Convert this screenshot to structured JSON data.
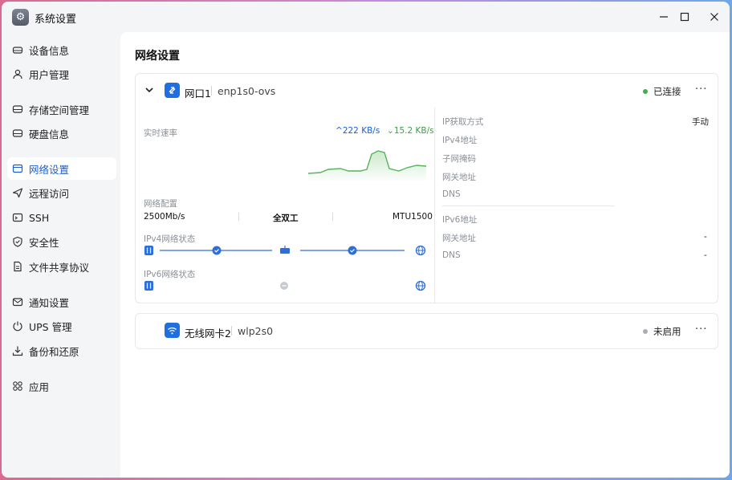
{
  "window": {
    "title": "系统设置"
  },
  "sidebar": {
    "items": [
      {
        "label": "设备信息",
        "icon": "drive-icon"
      },
      {
        "label": "用户管理",
        "icon": "user-icon"
      },
      {
        "label": "存储空间管理",
        "icon": "storage-icon"
      },
      {
        "label": "硬盘信息",
        "icon": "disk-icon"
      },
      {
        "label": "网络设置",
        "icon": "network-icon",
        "active": true
      },
      {
        "label": "远程访问",
        "icon": "send-icon"
      },
      {
        "label": "SSH",
        "icon": "terminal-icon"
      },
      {
        "label": "安全性",
        "icon": "shield-icon"
      },
      {
        "label": "文件共享协议",
        "icon": "file-icon"
      },
      {
        "label": "通知设置",
        "icon": "mail-icon"
      },
      {
        "label": "UPS 管理",
        "icon": "power-icon"
      },
      {
        "label": "备份和还原",
        "icon": "download-icon"
      },
      {
        "label": "应用",
        "icon": "apps-icon"
      }
    ]
  },
  "main": {
    "title": "网络设置",
    "interfaces": [
      {
        "name": "网口1",
        "device": "enp1s0-ovs",
        "status": "已连接",
        "status_color": "#3fae4f",
        "speed_label": "实时速率",
        "upload": "222 KB/s",
        "download": "15.2 KB/s",
        "config_label": "网络配置",
        "config": {
          "speed": "2500Mb/s",
          "duplex": "全双工",
          "mtu": "MTU1500"
        },
        "ipv4_status_label": "IPv4网络状态",
        "ipv6_status_label": "IPv6网络状态",
        "ipv4_details": [
          {
            "label": "IP获取方式",
            "value": "手动"
          },
          {
            "label": "IPv4地址",
            "value": ""
          },
          {
            "label": "子网掩码",
            "value": ""
          },
          {
            "label": "网关地址",
            "value": ""
          },
          {
            "label": "DNS",
            "value": ""
          }
        ],
        "ipv6_details": [
          {
            "label": "IPv6地址",
            "value": ""
          },
          {
            "label": "网关地址",
            "value": "-"
          },
          {
            "label": "DNS",
            "value": "-"
          }
        ]
      },
      {
        "name": "无线网卡2",
        "device": "wlp2s0",
        "status": "未启用",
        "status_color": "#a9aeb5"
      }
    ]
  },
  "colors": {
    "accent": "#1a5fd0",
    "upload": "#1a5fd0",
    "download": "#3f9b4a",
    "graph": "#6cc06f"
  }
}
